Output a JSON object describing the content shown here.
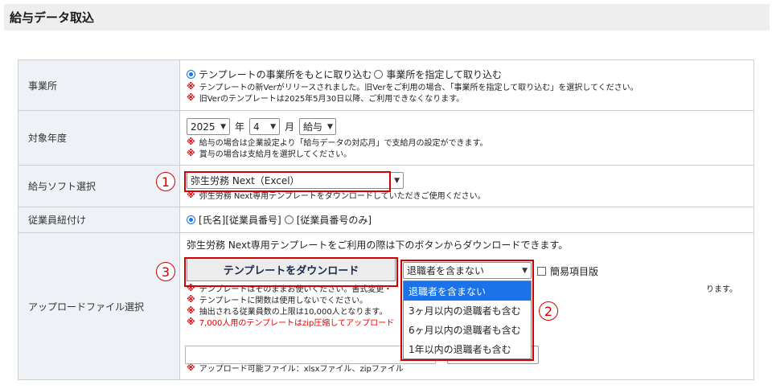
{
  "page": {
    "title": "給与データ取込"
  },
  "colors": {
    "accent": "#1a73e8",
    "warning": "#d20000"
  },
  "rows": {
    "office": {
      "label": "事業所",
      "option1": "テンプレートの事業所をもとに取り込む",
      "option2": "事業所を指定して取り込む",
      "selected": "option1",
      "note1": "テンプレートの新Verがリリースされました。旧Verをご利用の場合、「事業所を指定して取り込む」を選択してください。",
      "note2": "旧Verのテンプレートは2025年5月30日以降、ご利用できなくなります。"
    },
    "year": {
      "label": "対象年度",
      "year_value": "2025",
      "year_unit": "年",
      "month_value": "4",
      "month_unit": "月",
      "type_value": "給与",
      "note1": "給与の場合は企業設定より「給与データの対応月」で支給月の設定ができます。",
      "note2": "賞与の場合は支給月を選択してください。"
    },
    "software": {
      "label": "給与ソフト選択",
      "value": "弥生労務 Next（Excel）",
      "note": "弥生労務 Next専用テンプレートをダウンロードしていただきご使用ください。",
      "marker": "1"
    },
    "employee_link": {
      "label": "従業員紐付け",
      "option1": "[氏名][従業員番号]",
      "option2": "[従業員番号のみ]",
      "selected": "option1"
    },
    "upload": {
      "label": "アップロードファイル選択",
      "intro": "弥生労務 Next専用テンプレートをご利用の際は下のボタンからダウンロードできます。",
      "download_button": "テンプレートをダウンロード",
      "download_marker": "3",
      "retiree_select": "退職者を含まない",
      "retiree_marker": "2",
      "simple_checkbox": "簡易項目版",
      "notes": [
        "テンプレートはそのままお使いください。書式変更・",
        "テンプレートに関数は使用しないでください。",
        "抽出される従業員数の上限は10,000人となります。",
        "7,000人用のテンプレートはzip圧縮してアップロード"
      ],
      "notes_tail": "ります。",
      "dropdown_options": [
        "退職者を含まない",
        "3ヶ月以内の退職者も含む",
        "6ヶ月以内の退職者も含む",
        "1年以内の退職者も含む"
      ],
      "file_note": "アップロード可能ファイル：xlsxファイル、zipファイル"
    }
  },
  "mark_symbol": "※"
}
